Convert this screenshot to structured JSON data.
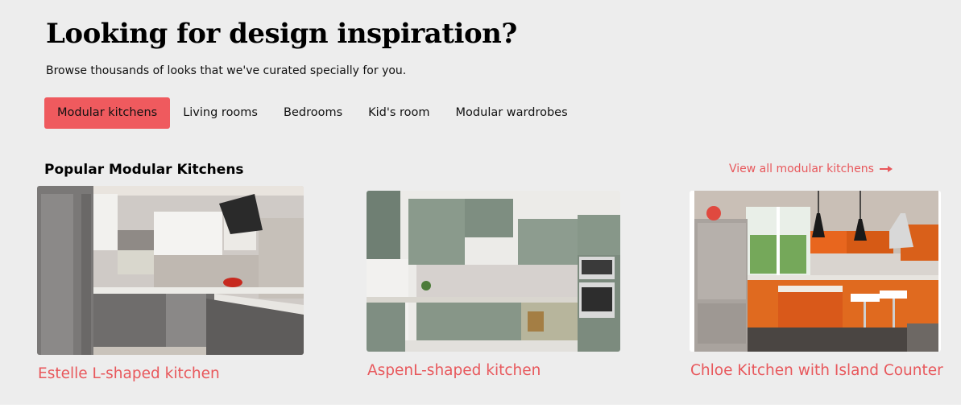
{
  "header": {
    "title": "Looking for design inspiration?",
    "subtitle": "Browse thousands of looks that we've curated specially for you."
  },
  "tabs": [
    {
      "label": "Modular kitchens",
      "active": true
    },
    {
      "label": "Living rooms",
      "active": false
    },
    {
      "label": "Bedrooms",
      "active": false
    },
    {
      "label": "Kid's room",
      "active": false
    },
    {
      "label": "Modular wardrobes",
      "active": false
    }
  ],
  "section": {
    "title": "Popular Modular Kitchens",
    "view_all_label": "View all modular kitchens",
    "view_all_icon": "arrow-right-icon"
  },
  "cards": [
    {
      "title": "Estelle L-shaped kitchen",
      "image": "kitchen-photo-grey-l-shaped"
    },
    {
      "title": "AspenL-shaped kitchen",
      "image": "kitchen-photo-sage-green-l-shaped"
    },
    {
      "title": "Chloe Kitchen with Island Counter",
      "image": "kitchen-photo-orange-island"
    }
  ],
  "colors": {
    "accent": "#ef5a5e",
    "link": "#e8585c",
    "background": "#ededed"
  }
}
